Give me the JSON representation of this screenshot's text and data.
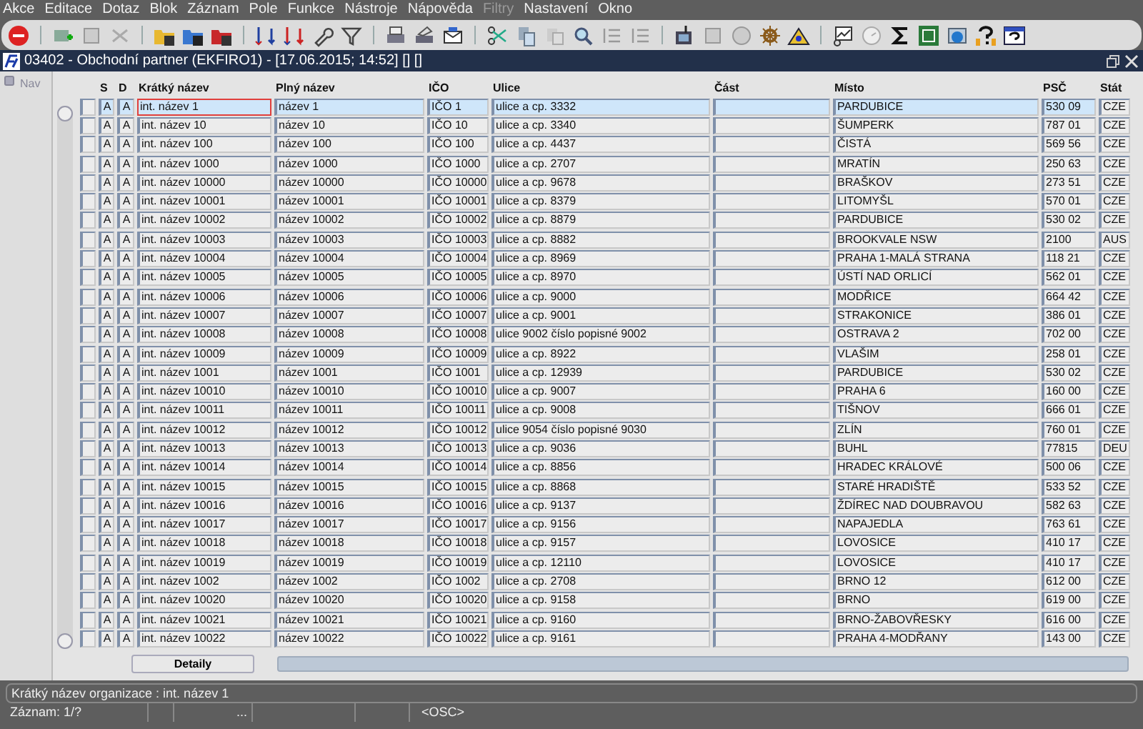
{
  "menu": [
    {
      "label": "Akce",
      "disabled": false
    },
    {
      "label": "Editace",
      "disabled": false
    },
    {
      "label": "Dotaz",
      "disabled": false
    },
    {
      "label": "Blok",
      "disabled": false
    },
    {
      "label": "Záznam",
      "disabled": false
    },
    {
      "label": "Pole",
      "disabled": false
    },
    {
      "label": "Funkce",
      "disabled": false
    },
    {
      "label": "Nástroje",
      "disabled": false
    },
    {
      "label": "Nápověda",
      "disabled": false
    },
    {
      "label": "Filtry",
      "disabled": true
    },
    {
      "label": "Nastavení",
      "disabled": false
    },
    {
      "label": "Okno",
      "disabled": false
    }
  ],
  "window": {
    "title": "03402 - Obchodní partner (EKFIRO1) - [17.06.2015; 14:52] [] []"
  },
  "nav": {
    "label": "Nav"
  },
  "table": {
    "columns": [
      "",
      "S",
      "D",
      "Krátký název",
      "Plný název",
      "IČO",
      "Ulice",
      "Část",
      "Místo",
      "PSČ",
      "Stát"
    ],
    "rows": [
      {
        "selected": true,
        "cells": [
          "",
          "A",
          "A",
          "int. název 1",
          "název 1",
          "IČO 1",
          "ulice a cp. 3332",
          "",
          "PARDUBICE",
          "530 09",
          "CZE"
        ]
      },
      {
        "selected": false,
        "cells": [
          "",
          "A",
          "A",
          "int. název 10",
          "název 10",
          "IČO 10",
          "ulice a cp. 3340",
          "",
          "ŠUMPERK",
          "787 01",
          "CZE"
        ]
      },
      {
        "selected": false,
        "cells": [
          "",
          "A",
          "A",
          "int. název 100",
          "název 100",
          "IČO 100",
          "ulice a cp. 4437",
          "",
          "ČISTÁ",
          "569 56",
          "CZE"
        ]
      },
      {
        "selected": false,
        "cells": [
          "",
          "A",
          "A",
          "int. název 1000",
          "název 1000",
          "IČO 1000",
          "ulice a cp. 2707",
          "",
          "MRATÍN",
          "250 63",
          "CZE"
        ]
      },
      {
        "selected": false,
        "cells": [
          "",
          "A",
          "A",
          "int. název 10000",
          "název 10000",
          "IČO 10000",
          "ulice a cp. 9678",
          "",
          "BRAŠKOV",
          "273 51",
          "CZE"
        ]
      },
      {
        "selected": false,
        "cells": [
          "",
          "A",
          "A",
          "int. název 10001",
          "název 10001",
          "IČO 10001",
          "ulice a cp. 8379",
          "",
          "LITOMYŠL",
          "570 01",
          "CZE"
        ]
      },
      {
        "selected": false,
        "cells": [
          "",
          "A",
          "A",
          "int. název 10002",
          "název 10002",
          "IČO 10002",
          "ulice a cp. 8879",
          "",
          "PARDUBICE",
          "530 02",
          "CZE"
        ]
      },
      {
        "selected": false,
        "cells": [
          "",
          "A",
          "A",
          "int. název 10003",
          "název 10003",
          "IČO 10003",
          "ulice a cp. 8882",
          "",
          "BROOKVALE NSW",
          "2100",
          "AUS"
        ]
      },
      {
        "selected": false,
        "cells": [
          "",
          "A",
          "A",
          "int. název 10004",
          "název 10004",
          "IČO 10004",
          "ulice a cp. 8969",
          "",
          "PRAHA 1-MALÁ STRANA",
          "118 21",
          "CZE"
        ]
      },
      {
        "selected": false,
        "cells": [
          "",
          "A",
          "A",
          "int. název 10005",
          "název 10005",
          "IČO 10005",
          "ulice a cp. 8970",
          "",
          "ÚSTÍ NAD ORLICÍ",
          "562 01",
          "CZE"
        ]
      },
      {
        "selected": false,
        "cells": [
          "",
          "A",
          "A",
          "int. název 10006",
          "název 10006",
          "IČO 10006",
          "ulice a cp. 9000",
          "",
          "MODŘICE",
          "664 42",
          "CZE"
        ]
      },
      {
        "selected": false,
        "cells": [
          "",
          "A",
          "A",
          "int. název 10007",
          "název 10007",
          "IČO 10007",
          "ulice a cp. 9001",
          "",
          "STRAKONICE",
          "386 01",
          "CZE"
        ]
      },
      {
        "selected": false,
        "cells": [
          "",
          "A",
          "A",
          "int. název 10008",
          "název 10008",
          "IČO 10008",
          "ulice 9002 číslo popisné 9002",
          "",
          "OSTRAVA 2",
          "702 00",
          "CZE"
        ]
      },
      {
        "selected": false,
        "cells": [
          "",
          "A",
          "A",
          "int. název 10009",
          "název 10009",
          "IČO 10009",
          "ulice a cp. 8922",
          "",
          "VLAŠIM",
          "258 01",
          "CZE"
        ]
      },
      {
        "selected": false,
        "cells": [
          "",
          "A",
          "A",
          "int. název 1001",
          "název 1001",
          "IČO 1001",
          "ulice a cp. 12939",
          "",
          "PARDUBICE",
          "530 02",
          "CZE"
        ]
      },
      {
        "selected": false,
        "cells": [
          "",
          "A",
          "A",
          "int. název 10010",
          "název 10010",
          "IČO 10010",
          "ulice a cp. 9007",
          "",
          "PRAHA 6",
          "160 00",
          "CZE"
        ]
      },
      {
        "selected": false,
        "cells": [
          "",
          "A",
          "A",
          "int. název 10011",
          "název 10011",
          "IČO 10011",
          "ulice a cp. 9008",
          "",
          "TIŠNOV",
          "666 01",
          "CZE"
        ]
      },
      {
        "selected": false,
        "cells": [
          "",
          "A",
          "A",
          "int. název 10012",
          "název 10012",
          "IČO 10012",
          "ulice 9054 číslo popisné 9030",
          "",
          "ZLÍN",
          "760 01",
          "CZE"
        ]
      },
      {
        "selected": false,
        "cells": [
          "",
          "A",
          "A",
          "int. název 10013",
          "název 10013",
          "IČO 10013",
          "ulice a cp. 9036",
          "",
          "BUHL",
          "77815",
          "DEU"
        ]
      },
      {
        "selected": false,
        "cells": [
          "",
          "A",
          "A",
          "int. název 10014",
          "název 10014",
          "IČO 10014",
          "ulice a cp. 8856",
          "",
          "HRADEC KRÁLOVÉ",
          "500 06",
          "CZE"
        ]
      },
      {
        "selected": false,
        "cells": [
          "",
          "A",
          "A",
          "int. název 10015",
          "název 10015",
          "IČO 10015",
          "ulice a cp. 8868",
          "",
          "STARÉ HRADIŠTĚ",
          "533 52",
          "CZE"
        ]
      },
      {
        "selected": false,
        "cells": [
          "",
          "A",
          "A",
          "int. název 10016",
          "název 10016",
          "IČO 10016",
          "ulice a cp. 9137",
          "",
          "ŽDÍREC NAD DOUBRAVOU",
          "582 63",
          "CZE"
        ]
      },
      {
        "selected": false,
        "cells": [
          "",
          "A",
          "A",
          "int. název 10017",
          "název 10017",
          "IČO 10017",
          "ulice a cp. 9156",
          "",
          "NAPAJEDLA",
          "763 61",
          "CZE"
        ]
      },
      {
        "selected": false,
        "cells": [
          "",
          "A",
          "A",
          "int. název 10018",
          "název 10018",
          "IČO 10018",
          "ulice a cp. 9157",
          "",
          "LOVOSICE",
          "410 17",
          "CZE"
        ]
      },
      {
        "selected": false,
        "cells": [
          "",
          "A",
          "A",
          "int. název 10019",
          "název 10019",
          "IČO 10019",
          "ulice a cp. 12110",
          "",
          "LOVOSICE",
          "410 17",
          "CZE"
        ]
      },
      {
        "selected": false,
        "cells": [
          "",
          "A",
          "A",
          "int. název 1002",
          "název 1002",
          "IČO 1002",
          "ulice a cp. 2708",
          "",
          "BRNO 12",
          "612 00",
          "CZE"
        ]
      },
      {
        "selected": false,
        "cells": [
          "",
          "A",
          "A",
          "int. název 10020",
          "název 10020",
          "IČO 10020",
          "ulice a cp. 9158",
          "",
          "BRNO",
          "619 00",
          "CZE"
        ]
      },
      {
        "selected": false,
        "cells": [
          "",
          "A",
          "A",
          "int. název 10021",
          "název 10021",
          "IČO 10021",
          "ulice a cp. 9160",
          "",
          "BRNO-ŽABOVŘESKY",
          "616 00",
          "CZE"
        ]
      },
      {
        "selected": false,
        "cells": [
          "",
          "A",
          "A",
          "int. název 10022",
          "název 10022",
          "IČO 10022",
          "ulice a cp. 9161",
          "",
          "PRAHA 4-MODŘANY",
          "143 00",
          "CZE"
        ]
      }
    ]
  },
  "detail_button": "Detaily",
  "status_bar": {
    "hint": "Krátký název organizace : int. název 1",
    "record": "Záznam: 1/?",
    "field_3": "...",
    "mode": "<OSC>"
  }
}
